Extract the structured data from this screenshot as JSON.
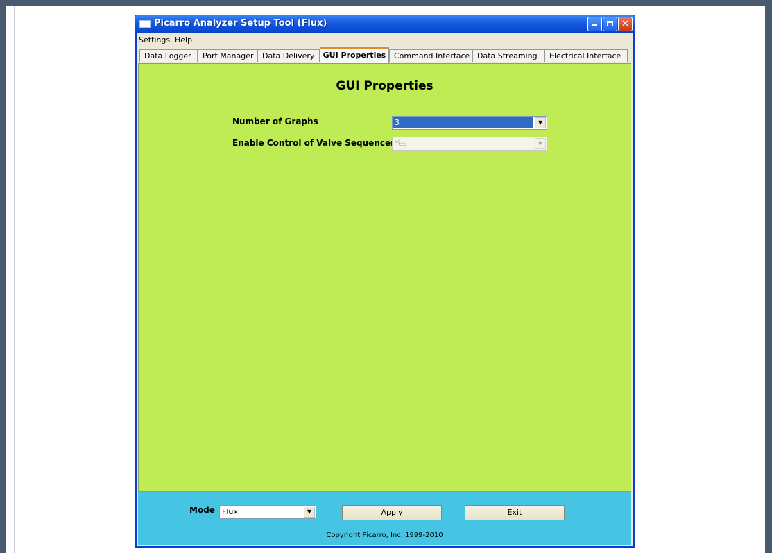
{
  "window": {
    "title": "Picarro Analyzer Setup Tool (Flux)"
  },
  "menu": [
    "Settings",
    "Help"
  ],
  "tabs": [
    {
      "label": "Data Logger",
      "active": false
    },
    {
      "label": "Port Manager",
      "active": false
    },
    {
      "label": "Data Delivery",
      "active": false
    },
    {
      "label": "GUI Properties",
      "active": true
    },
    {
      "label": "Command Interface",
      "active": false
    },
    {
      "label": "Data Streaming",
      "active": false
    },
    {
      "label": "Electrical Interface",
      "active": false
    }
  ],
  "panel": {
    "title": "GUI Properties",
    "background": "#bfeb55",
    "fields": [
      {
        "label": "Number of Graphs",
        "value": "3",
        "enabled": true
      },
      {
        "label": "Enable Control of Valve Sequencer",
        "value": "Yes",
        "enabled": false
      }
    ]
  },
  "footer": {
    "mode_label": "Mode",
    "mode_value": "Flux",
    "apply_label": "Apply",
    "exit_label": "Exit",
    "copyright": "Copyright Picarro, Inc. 1999-2010",
    "background": "#45c4e4"
  },
  "icons": [
    "app-icon",
    "minimize-icon",
    "maximize-icon",
    "close-icon",
    "dropdown-arrow-icon"
  ]
}
